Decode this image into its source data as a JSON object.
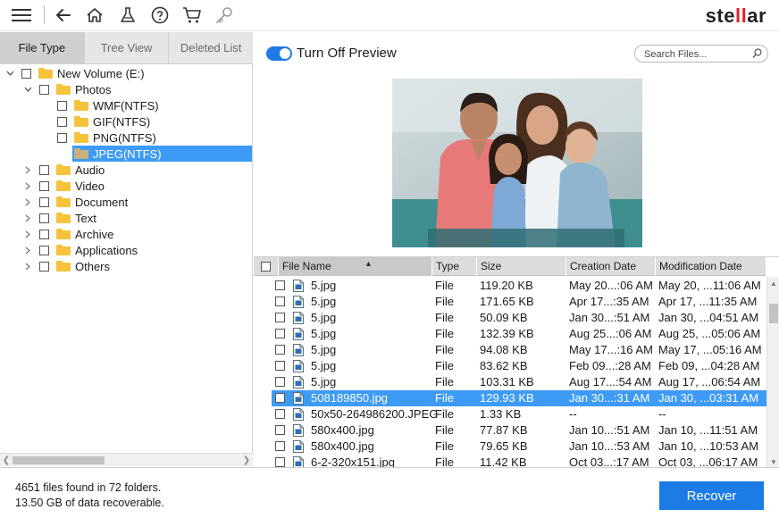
{
  "toolbar": {
    "icons": [
      "menu-icon",
      "back-arrow-icon",
      "home-icon",
      "scan-icon",
      "help-icon",
      "cart-icon",
      "key-icon"
    ],
    "logo_text_a": "ste",
    "logo_text_b": "ll",
    "logo_text_c": "ar"
  },
  "tabs": [
    {
      "label": "File Type",
      "active": true
    },
    {
      "label": "Tree View",
      "active": false
    },
    {
      "label": "Deleted List",
      "active": false
    }
  ],
  "tree": [
    {
      "label": "New Volume (E:)",
      "depth": 0,
      "arrow": "expanded",
      "icon": "drive"
    },
    {
      "label": "Photos",
      "depth": 1,
      "arrow": "expanded",
      "icon": "folder"
    },
    {
      "label": "WMF(NTFS)",
      "depth": 2,
      "arrow": "none",
      "icon": "folder"
    },
    {
      "label": "GIF(NTFS)",
      "depth": 2,
      "arrow": "none",
      "icon": "folder"
    },
    {
      "label": "PNG(NTFS)",
      "depth": 2,
      "arrow": "none",
      "icon": "folder"
    },
    {
      "label": "JPEG(NTFS)",
      "depth": 2,
      "arrow": "none",
      "icon": "folder",
      "selected": true
    },
    {
      "label": "Audio",
      "depth": 1,
      "arrow": "collapsed",
      "icon": "folder"
    },
    {
      "label": "Video",
      "depth": 1,
      "arrow": "collapsed",
      "icon": "folder"
    },
    {
      "label": "Document",
      "depth": 1,
      "arrow": "collapsed",
      "icon": "folder"
    },
    {
      "label": "Text",
      "depth": 1,
      "arrow": "collapsed",
      "icon": "folder"
    },
    {
      "label": "Archive",
      "depth": 1,
      "arrow": "collapsed",
      "icon": "folder"
    },
    {
      "label": "Applications",
      "depth": 1,
      "arrow": "collapsed",
      "icon": "folder"
    },
    {
      "label": "Others",
      "depth": 1,
      "arrow": "collapsed",
      "icon": "folder"
    }
  ],
  "preview": {
    "toggle_label": "Turn Off Preview",
    "toggle_on": true,
    "search_placeholder": "Search Files...",
    "image": "photo-preview"
  },
  "table": {
    "columns": [
      "File Name",
      "Type",
      "Size",
      "Creation Date",
      "Modification Date"
    ],
    "rows": [
      {
        "name": "5.jpg",
        "type": "File",
        "size": "119.20 KB",
        "created": "May 20...:06 AM",
        "modified": "May 20, ...11:06 AM"
      },
      {
        "name": "5.jpg",
        "type": "File",
        "size": "171.65 KB",
        "created": "Apr 17...:35 AM",
        "modified": "Apr 17, ...11:35 AM"
      },
      {
        "name": "5.jpg",
        "type": "File",
        "size": "50.09 KB",
        "created": "Jan 30...:51 AM",
        "modified": "Jan 30, ...04:51 AM"
      },
      {
        "name": "5.jpg",
        "type": "File",
        "size": "132.39 KB",
        "created": "Aug 25...:06 AM",
        "modified": "Aug 25, ...05:06 AM"
      },
      {
        "name": "5.jpg",
        "type": "File",
        "size": "94.08 KB",
        "created": "May 17...:16 AM",
        "modified": "May 17, ...05:16 AM"
      },
      {
        "name": "5.jpg",
        "type": "File",
        "size": "83.62 KB",
        "created": "Feb 09...:28 AM",
        "modified": "Feb 09, ...04:28 AM"
      },
      {
        "name": "5.jpg",
        "type": "File",
        "size": "103.31 KB",
        "created": "Aug 17...:54 AM",
        "modified": "Aug 17, ...06:54 AM"
      },
      {
        "name": "508189850.jpg",
        "type": "File",
        "size": "129.93 KB",
        "created": "Jan 30...:31 AM",
        "modified": "Jan 30, ...03:31 AM",
        "selected": true
      },
      {
        "name": "50x50-264986200.JPEG",
        "type": "File",
        "size": "1.33 KB",
        "created": "--",
        "modified": "--"
      },
      {
        "name": "580x400.jpg",
        "type": "File",
        "size": "77.87 KB",
        "created": "Jan 10...:51 AM",
        "modified": "Jan 10, ...11:51 AM"
      },
      {
        "name": "580x400.jpg",
        "type": "File",
        "size": "79.65 KB",
        "created": "Jan 10...:53 AM",
        "modified": "Jan 10, ...10:53 AM"
      },
      {
        "name": "6-2-320x151.jpg",
        "type": "File",
        "size": "11.42 KB",
        "created": "Oct 03...:17 AM",
        "modified": "Oct 03, ...06:17 AM"
      }
    ]
  },
  "footer": {
    "files_found": "4651 files found in 72 folders.",
    "recoverable": "13.50 GB of data recoverable.",
    "recover_label": "Recover"
  },
  "colors": {
    "accent": "#1d7be6",
    "selection": "#3e9bf5",
    "folder": "#f6c33c",
    "logo_red": "#d9232d"
  }
}
